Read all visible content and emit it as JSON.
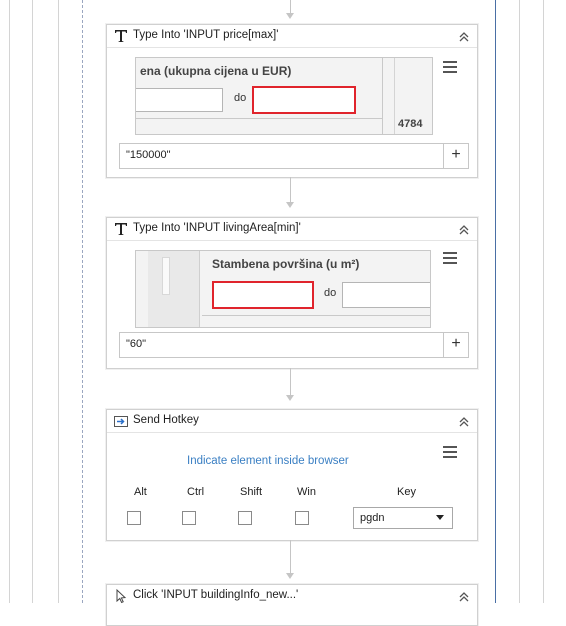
{
  "activities": [
    {
      "title": "Type Into 'INPUT  price[max]'",
      "screenshot": {
        "label": "ena (ukupna cijena u EUR)",
        "separator": "do",
        "side_number": "4784"
      },
      "value": "\"150000\""
    },
    {
      "title": "Type Into 'INPUT  livingArea[min]'",
      "screenshot": {
        "label": "Stambena površina (u m²)",
        "separator": "do"
      },
      "value": "\"60\""
    },
    {
      "title": "Send Hotkey",
      "indicate_link": "Indicate element inside browser",
      "modifiers": {
        "alt": "Alt",
        "ctrl": "Ctrl",
        "shift": "Shift",
        "win": "Win"
      },
      "key_label": "Key",
      "key_value": "pgdn"
    },
    {
      "title": "Click 'INPUT  buildingInfo_new...'"
    }
  ],
  "add_symbol": "+",
  "colors": {
    "link": "#3a7fc3",
    "highlight": "#e0242c",
    "guide": "#4a6fa5"
  }
}
